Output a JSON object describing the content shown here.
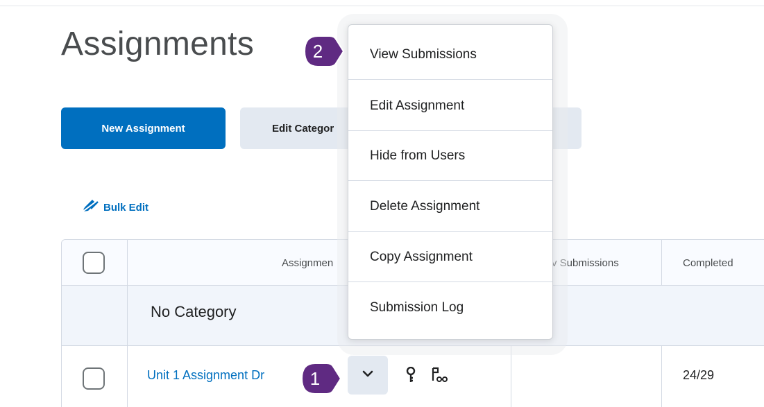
{
  "page": {
    "title": "Assignments"
  },
  "toolbar": {
    "new_assignment_label": "New Assignment",
    "edit_categories_label": "Edit Categor",
    "bulk_edit_label": "Bulk Edit"
  },
  "table": {
    "headers": {
      "assignment": "Assignmen",
      "new_submissions": "v Submissions",
      "completed": "Completed"
    },
    "category_label": "No Category",
    "rows": [
      {
        "name": "Unit 1 Assignment Dr",
        "completed": "24/29"
      }
    ]
  },
  "dropdown_menu": {
    "items": [
      "View Submissions",
      "Edit Assignment",
      "Hide from Users",
      "Delete Assignment",
      "Copy Assignment",
      "Submission Log"
    ]
  },
  "callouts": {
    "badge_1": "1",
    "badge_2": "2"
  },
  "colors": {
    "primary": "#006fbf",
    "secondary_button": "#e3e9f1",
    "callout_badge": "#5f2a82",
    "link": "#006fbf"
  },
  "icons": {
    "chevron": "chevron-down-icon",
    "key": "key-icon",
    "release_conditions": "release-conditions-icon",
    "bulk_edit": "pencil-icon"
  }
}
